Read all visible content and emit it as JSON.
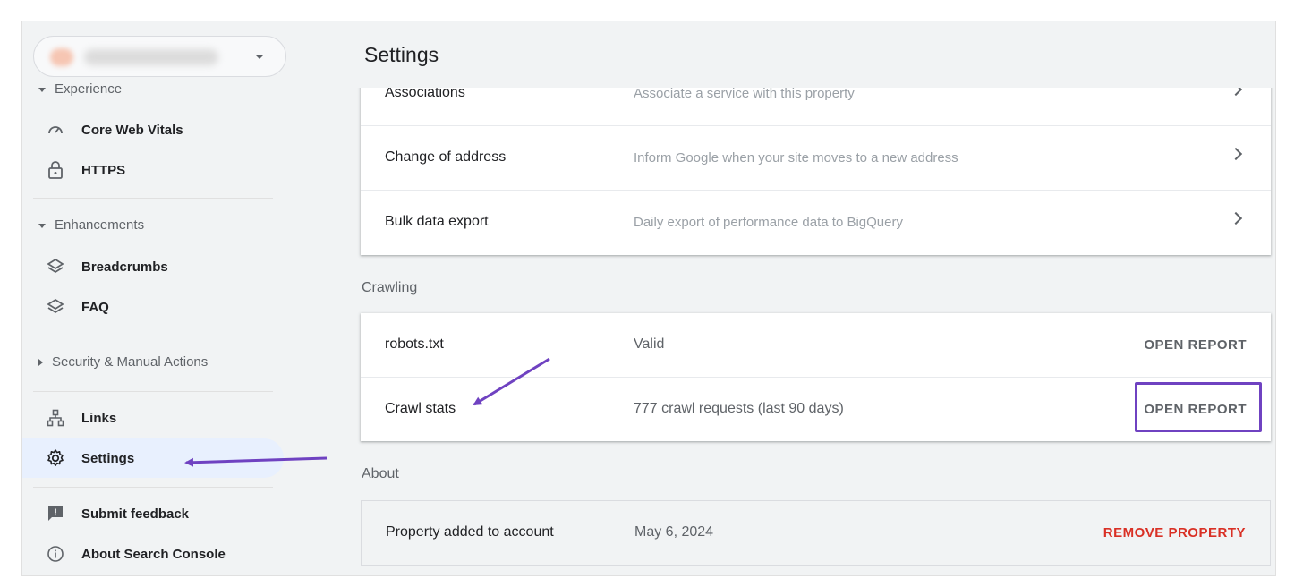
{
  "sidebar": {
    "sections": {
      "experience": "Experience",
      "enhancements": "Enhancements",
      "security": "Security & Manual Actions"
    },
    "items": {
      "core_web_vitals": "Core Web Vitals",
      "https": "HTTPS",
      "breadcrumbs": "Breadcrumbs",
      "faq": "FAQ",
      "links": "Links",
      "settings": "Settings",
      "submit_feedback": "Submit feedback",
      "about": "About Search Console"
    }
  },
  "main": {
    "title": "Settings",
    "general_rows": [
      {
        "name": "Associations",
        "desc": "Associate a service with this property"
      },
      {
        "name": "Change of address",
        "desc": "Inform Google when your site moves to a new address"
      },
      {
        "name": "Bulk data export",
        "desc": "Daily export of performance data to BigQuery"
      }
    ],
    "crawling": {
      "label": "Crawling",
      "rows": [
        {
          "name": "robots.txt",
          "value": "Valid",
          "action": "OPEN REPORT"
        },
        {
          "name": "Crawl stats",
          "value": "777 crawl requests (last 90 days)",
          "action": "OPEN REPORT"
        }
      ]
    },
    "about": {
      "label": "About",
      "rows": [
        {
          "name": "Property added to account",
          "value": "May 6, 2024",
          "action": "REMOVE PROPERTY"
        }
      ]
    }
  },
  "colors": {
    "annotation": "#6f42c1",
    "active_nav": "#e8f0fe",
    "danger": "#d93025"
  }
}
